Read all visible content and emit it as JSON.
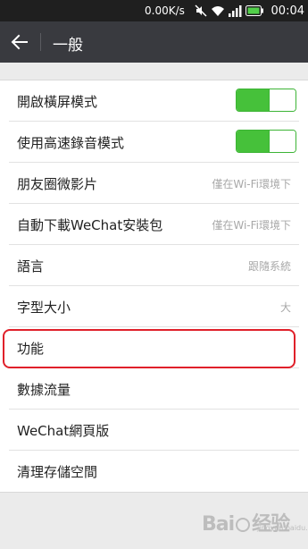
{
  "status_bar": {
    "net_speed": "0.00K/s",
    "time": "00:04"
  },
  "header": {
    "title": "一般"
  },
  "settings": [
    {
      "label": "開啟橫屏模式",
      "toggle": {
        "on": true,
        "fill_fraction": 0.55
      }
    },
    {
      "label": "使用高速錄音模式",
      "toggle": {
        "on": true,
        "fill_fraction": 0.55
      }
    },
    {
      "label": "朋友圈微影片",
      "value": "僅在Wi-Fi環境下"
    },
    {
      "label": "自動下載WeChat安裝包",
      "value": "僅在Wi-Fi環境下"
    },
    {
      "label": "語言",
      "value": "跟隨系統"
    },
    {
      "label": "字型大小",
      "value": "大"
    },
    {
      "label": "功能",
      "highlighted": true
    },
    {
      "label": "數據流量"
    },
    {
      "label": "WeChat網頁版"
    },
    {
      "label": "清理存儲空間"
    }
  ],
  "colors": {
    "toggle_on": "#46c13a",
    "header_bg": "#393a3f",
    "highlight": "#e0202a"
  },
  "watermark": {
    "text": "Bai 经验",
    "sub": "jingyan.baidu.com"
  }
}
